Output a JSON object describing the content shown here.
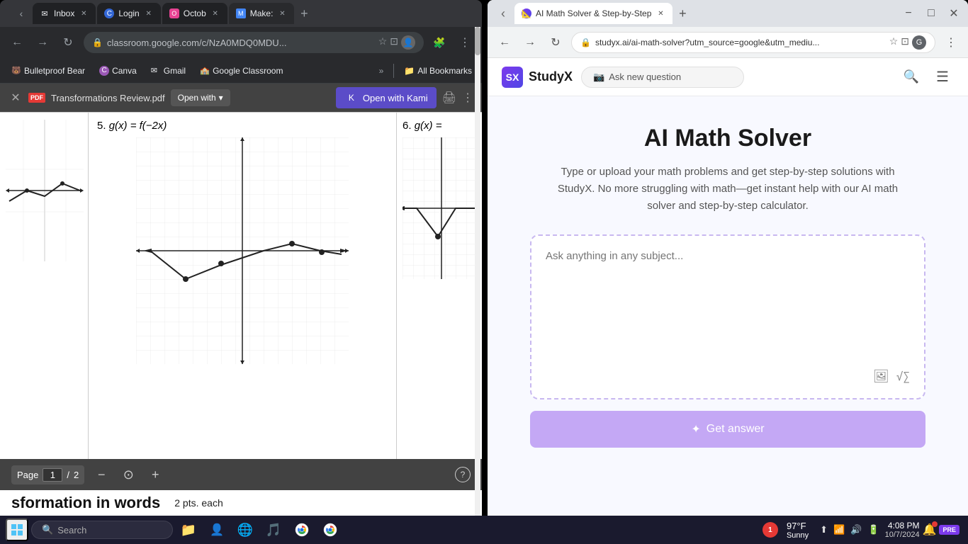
{
  "left_browser": {
    "tabs": [
      {
        "label": "Inbox",
        "favicon": "✉",
        "active": false,
        "id": "inbox"
      },
      {
        "label": "Login",
        "favicon": "C",
        "active": false,
        "id": "login"
      },
      {
        "label": "Octob",
        "favicon": "O",
        "active": false,
        "id": "octo"
      },
      {
        "label": "Make:",
        "favicon": "M",
        "active": true,
        "id": "maker"
      }
    ],
    "url": "classroom.google.com/c/NzA0MDQ0MDU...",
    "bookmarks": [
      {
        "label": "Bulletproof Bear",
        "favicon": "🐻"
      },
      {
        "label": "Canva",
        "favicon": "C"
      },
      {
        "label": "Gmail",
        "favicon": "✉"
      },
      {
        "label": "Google Classroom",
        "favicon": "🏫"
      }
    ],
    "all_bookmarks_label": "All Bookmarks",
    "pdf": {
      "filename": "Transformations Review.pdf",
      "open_with_label": "Open with",
      "open_kami_label": "Open with Kami",
      "problem5_label": "5.",
      "problem5_func": "g(x) = f(−2x)",
      "problem6_label": "6.",
      "problem6_func": "g(x) = ",
      "page_label": "Page",
      "page_current": "1",
      "page_total": "2",
      "partial_text": "sformation in words",
      "partial_text2": "2 pts. each"
    }
  },
  "right_browser": {
    "tabs": [
      {
        "label": "AI Math Solver & Step-by-Step",
        "favicon": "📐",
        "active": true,
        "id": "studyx"
      }
    ],
    "url": "studyx.ai/ai-math-solver?utm_source=google&utm_mediu...",
    "window_controls": [
      "−",
      "□",
      "✕"
    ],
    "nav": {
      "logo_text": "StudyX",
      "ask_btn_label": "Ask new question",
      "search_icon": "🔍",
      "menu_icon": "☰"
    },
    "content": {
      "title": "AI Math Solver",
      "description": "Type or upload your math problems and get step-by-step solutions with StudyX. No more struggling with math—get instant help with our AI math solver and step-by-step calculator.",
      "textarea_placeholder": "Ask anything in any subject...",
      "img_icon": "🖼",
      "math_icon": "√∑",
      "get_answer_label": "✦ Get answer"
    }
  },
  "taskbar": {
    "search_placeholder": "Search",
    "weather_temp": "97°F",
    "weather_condition": "Sunny",
    "time": "4:08 PM",
    "date": "10/7/2024",
    "notification_count": "1",
    "apps": [
      {
        "name": "file-explorer",
        "icon": "📁"
      },
      {
        "name": "browser-chrome-1",
        "icon": "🌐"
      },
      {
        "name": "browser-chrome-2",
        "icon": "🌐"
      },
      {
        "name": "spotify",
        "icon": "🎵"
      },
      {
        "name": "chrome-main",
        "icon": "🔵"
      },
      {
        "name": "chrome-alt",
        "icon": "🔴"
      }
    ],
    "system_icons": [
      "🔔",
      "⬆",
      "🔊",
      "📶",
      "🔋",
      "💬"
    ]
  }
}
